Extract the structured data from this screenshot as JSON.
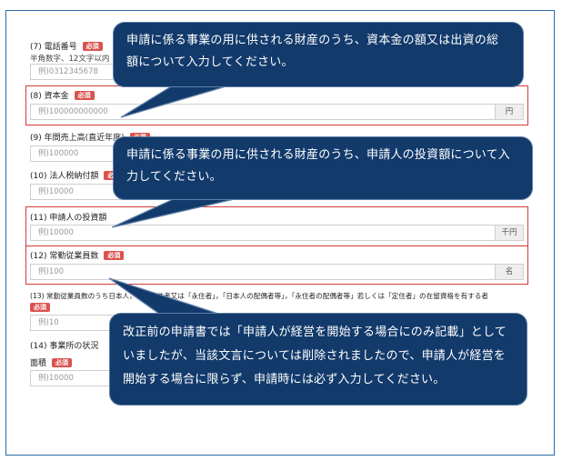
{
  "fields": {
    "phone": {
      "label": "(7) 電話番号",
      "required": "必須",
      "sublabel": "半角数字、12文字以内",
      "placeholder": "例)0312345678"
    },
    "capital": {
      "label": "(8) 資本金",
      "required": "必須",
      "placeholder": "例)100000000000",
      "unit": "円"
    },
    "sales": {
      "label": "(9) 年間売上高(直近年度)",
      "required": "必須",
      "placeholder": "例)100000"
    },
    "tax": {
      "label": "(10) 法人税納付額",
      "required": "必須",
      "placeholder": "例)10000"
    },
    "investment": {
      "label": "(11) 申請人の投資額",
      "placeholder": "例)10000",
      "unit": "千円"
    },
    "employees": {
      "label": "(12) 常勤従業員数",
      "required": "必須",
      "placeholder": "例)100",
      "unit": "名"
    },
    "employees_japanese": {
      "label": "(13) 常勤従業員数のうち日本人，特別永住者又は「永住者」，「日本人の配偶者等」，「永住者の配偶者等」若しくは「定住者」の在留資格を有する者",
      "required": "必須",
      "placeholder": "例)10"
    },
    "office": {
      "label": "(14) 事業所の状況",
      "area_label": "面積",
      "required": "必須",
      "placeholder": "例)10000"
    }
  },
  "callouts": {
    "top": "申請に係る事業の用に供される財産のうち、資本金の額又は出資の総額について入力してください。",
    "middle": "申請に係る事業の用に供される財産のうち、申請人の投資額について入力してください。",
    "bottom": "改正前の申請書では「申請人が経営を開始する場合にのみ記載」としていましたが、当該文言については削除されましたので、申請人が経営を開始する場合に限らず、申請時には必ず入力してください。"
  },
  "colors": {
    "callout_bg": "#123a6b",
    "highlight": "#d23a3a",
    "frame": "#2d6ba6",
    "required_badge": "#d9534f"
  }
}
